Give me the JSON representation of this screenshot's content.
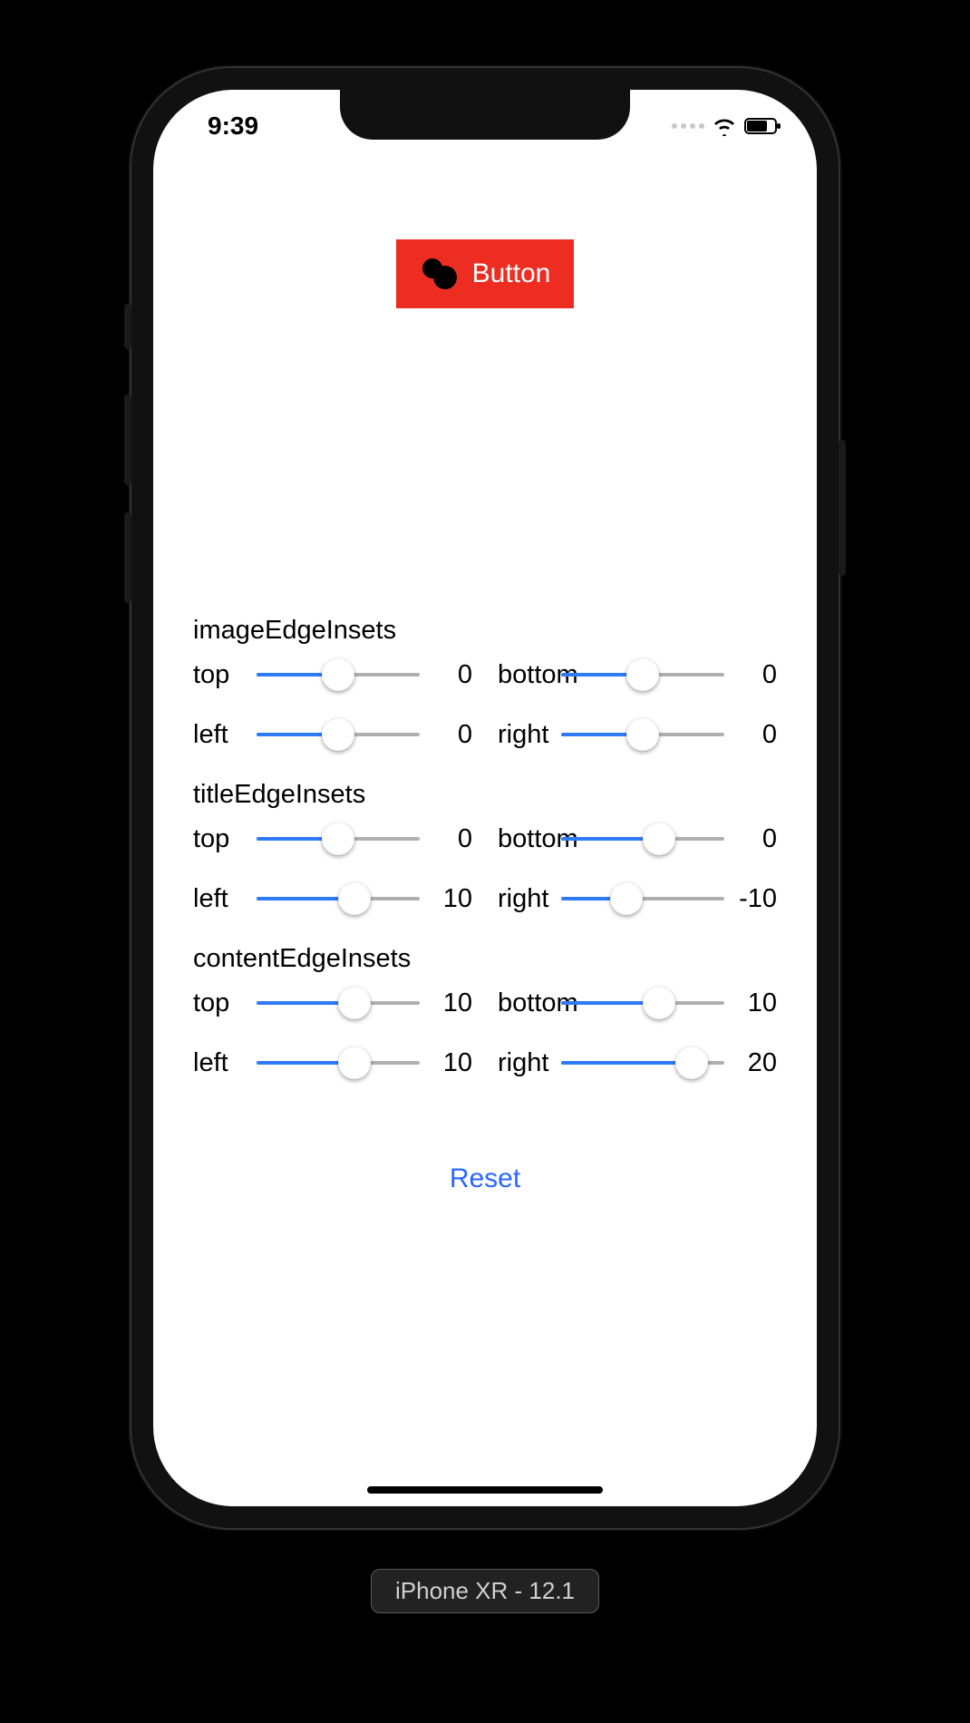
{
  "status": {
    "time": "9:39"
  },
  "button": {
    "label": "Button",
    "icon": "blob-icon",
    "bg": "#ee2d22"
  },
  "sections": {
    "imageEdgeInsets": {
      "title": "imageEdgeInsets",
      "top": {
        "label": "top",
        "value": 0,
        "thumbPct": 50,
        "fillPct": 50
      },
      "bottom": {
        "label": "bottom",
        "value": 0,
        "thumbPct": 50,
        "fillPct": 50
      },
      "left": {
        "label": "left",
        "value": 0,
        "thumbPct": 50,
        "fillPct": 50
      },
      "right": {
        "label": "right",
        "value": 0,
        "thumbPct": 50,
        "fillPct": 50
      }
    },
    "titleEdgeInsets": {
      "title": "titleEdgeInsets",
      "top": {
        "label": "top",
        "value": 0,
        "thumbPct": 50,
        "fillPct": 50
      },
      "bottom": {
        "label": "bottom",
        "value": 0,
        "thumbPct": 60,
        "fillPct": 60
      },
      "left": {
        "label": "left",
        "value": 10,
        "thumbPct": 60,
        "fillPct": 60
      },
      "right": {
        "label": "right",
        "value": -10,
        "thumbPct": 40,
        "fillPct": 40
      }
    },
    "contentEdgeInsets": {
      "title": "contentEdgeInsets",
      "top": {
        "label": "top",
        "value": 10,
        "thumbPct": 60,
        "fillPct": 60
      },
      "bottom": {
        "label": "bottom",
        "value": 10,
        "thumbPct": 60,
        "fillPct": 60
      },
      "left": {
        "label": "left",
        "value": 10,
        "thumbPct": 60,
        "fillPct": 60
      },
      "right": {
        "label": "right",
        "value": 20,
        "thumbPct": 80,
        "fillPct": 80
      }
    }
  },
  "reset": {
    "label": "Reset"
  },
  "deviceTag": "iPhone XR - 12.1"
}
